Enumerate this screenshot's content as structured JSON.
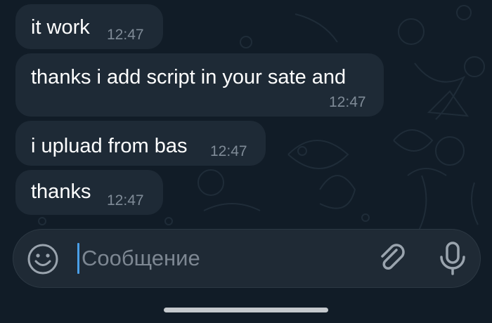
{
  "messages": [
    {
      "text": "it work",
      "time": "12:47"
    },
    {
      "text": "thanks i add script in your sate and",
      "time": "12:47"
    },
    {
      "text": "i upluad from bas",
      "time": "12:47"
    },
    {
      "text": "thanks",
      "time": "12:47"
    }
  ],
  "composer": {
    "placeholder": "Сообщение",
    "left_icon": "emoji-icon",
    "attach_icon": "paperclip-icon",
    "right_icon": "microphone-icon"
  },
  "colors": {
    "background": "#111c27",
    "bubble": "#1e2a36",
    "text": "#ffffff",
    "time": "#7f8b97",
    "caret": "#4a9fe8"
  }
}
